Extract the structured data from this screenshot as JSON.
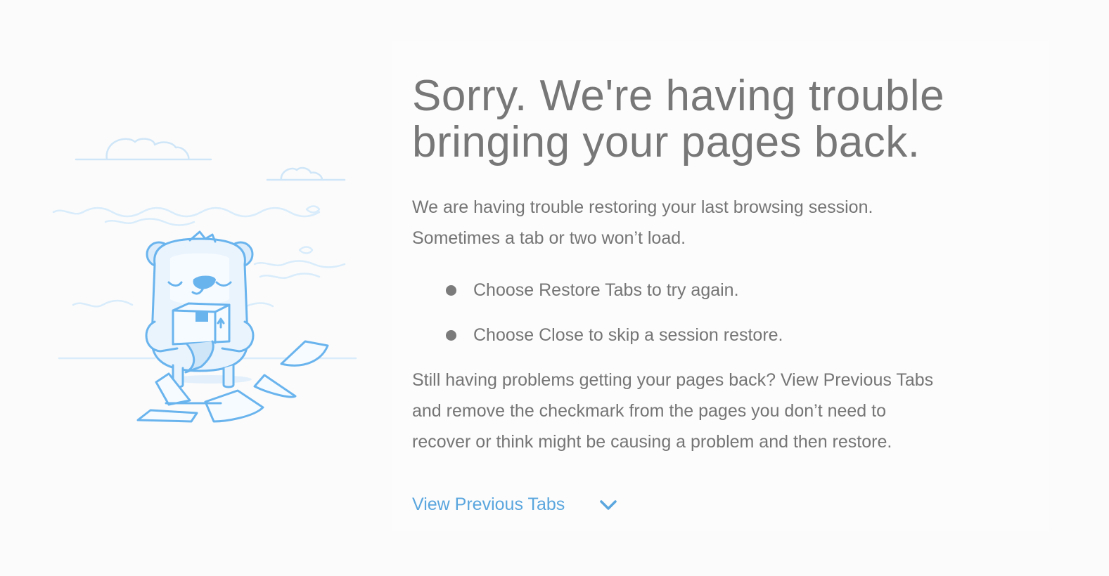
{
  "main": {
    "title_line1": "Sorry. We're having trouble",
    "title_line2": "bringing your pages back.",
    "description_line1": "We are having trouble restoring your last browsing session.",
    "description_line2": "Sometimes a tab or two won’t load.",
    "bullets": [
      "Choose Restore Tabs to try again.",
      "Choose Close to skip a session restore."
    ],
    "extra_line1": "Still having problems getting your pages back? View Previous Tabs",
    "extra_line2": "and remove the checkmark from the pages you don’t need to",
    "extra_line3": "recover or think might be causing a problem and then restore.",
    "view_previous_label": "View Previous Tabs",
    "view_previous_icon": "chevron-down-icon"
  },
  "colors": {
    "link": "#5aa6de",
    "text": "#757575",
    "illustration": "#6ab4ee"
  }
}
